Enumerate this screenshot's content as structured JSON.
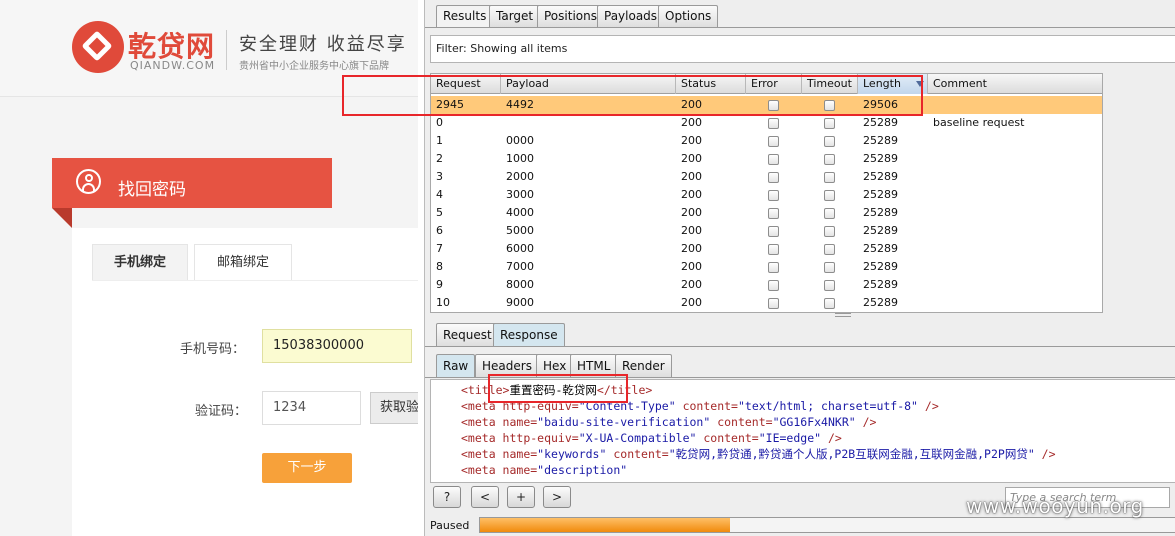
{
  "site": {
    "logo_cn": "乾贷网",
    "logo_en": "QIANDW.COM",
    "slogan": "安全理财 收益尽享",
    "subslogan": "贵州省中小企业服务中心旗下品牌",
    "banner_title": "找回密码",
    "tabs": [
      "手机绑定",
      "邮箱绑定"
    ],
    "phone_label": "手机号码：",
    "phone_value": "15038300000",
    "code_label": "验证码：",
    "code_value": "1234",
    "get_code_button": "获取验",
    "next_button": "下一步"
  },
  "burp": {
    "top_tabs": [
      "Results",
      "Target",
      "Positions",
      "Payloads",
      "Options"
    ],
    "filter_text": "Filter:  Showing all items",
    "columns": [
      "Request",
      "Payload",
      "Status",
      "Error",
      "Timeout",
      "Length",
      "Comment"
    ],
    "rows": [
      {
        "request": "2945",
        "payload": "4492",
        "status": "200",
        "length": "29506",
        "comment": "",
        "highlight": true
      },
      {
        "request": "0",
        "payload": "",
        "status": "200",
        "length": "25289",
        "comment": "baseline request"
      },
      {
        "request": "1",
        "payload": "0000",
        "status": "200",
        "length": "25289",
        "comment": ""
      },
      {
        "request": "2",
        "payload": "1000",
        "status": "200",
        "length": "25289",
        "comment": ""
      },
      {
        "request": "3",
        "payload": "2000",
        "status": "200",
        "length": "25289",
        "comment": ""
      },
      {
        "request": "4",
        "payload": "3000",
        "status": "200",
        "length": "25289",
        "comment": ""
      },
      {
        "request": "5",
        "payload": "4000",
        "status": "200",
        "length": "25289",
        "comment": ""
      },
      {
        "request": "6",
        "payload": "5000",
        "status": "200",
        "length": "25289",
        "comment": ""
      },
      {
        "request": "7",
        "payload": "6000",
        "status": "200",
        "length": "25289",
        "comment": ""
      },
      {
        "request": "8",
        "payload": "7000",
        "status": "200",
        "length": "25289",
        "comment": ""
      },
      {
        "request": "9",
        "payload": "8000",
        "status": "200",
        "length": "25289",
        "comment": ""
      },
      {
        "request": "10",
        "payload": "9000",
        "status": "200",
        "length": "25289",
        "comment": ""
      }
    ],
    "req_resp_tabs": [
      "Request",
      "Response"
    ],
    "view_tabs": [
      "Raw",
      "Headers",
      "Hex",
      "HTML",
      "Render"
    ],
    "code": {
      "title_open": "<title>",
      "title_text": "重置密码-乾贷网",
      "title_close": "</title>",
      "l2_tag": "<meta",
      "l2_attr": " http-equiv=",
      "l2_val": "\"Content-Type\"",
      "l2_attr2": " content=",
      "l2_val2": "\"text/html; charset=utf-8\"",
      "l2_end": " />",
      "l3_tag": "<meta",
      "l3_attr": " name=",
      "l3_val": "\"baidu-site-verification\"",
      "l3_attr2": " content=",
      "l3_val2": "\"GG16Fx4NKR\"",
      "l3_end": " />",
      "l4_tag": "<meta",
      "l4_attr": " http-equiv=",
      "l4_val": "\"X-UA-Compatible\"",
      "l4_attr2": " content=",
      "l4_val2": "\"IE=edge\"",
      "l4_end": " />",
      "l5_tag": "<meta",
      "l5_attr": " name=",
      "l5_val": "\"keywords\"",
      "l5_attr2": " content=",
      "l5_val2": "\"乾贷网,黔贷通,黔贷通个人版,P2B互联网金融,互联网金融,P2P网贷\"",
      "l5_end": " />",
      "l6_tag": "<meta",
      "l6_attr": " name=",
      "l6_val": "\"description\""
    },
    "help_button": "?",
    "prev_button": "<",
    "add_button": "+",
    "next_button": ">",
    "search_placeholder": "Type a search term",
    "paused_label": "Paused",
    "progress": 0.36
  },
  "watermark": "www.wooyun.org"
}
